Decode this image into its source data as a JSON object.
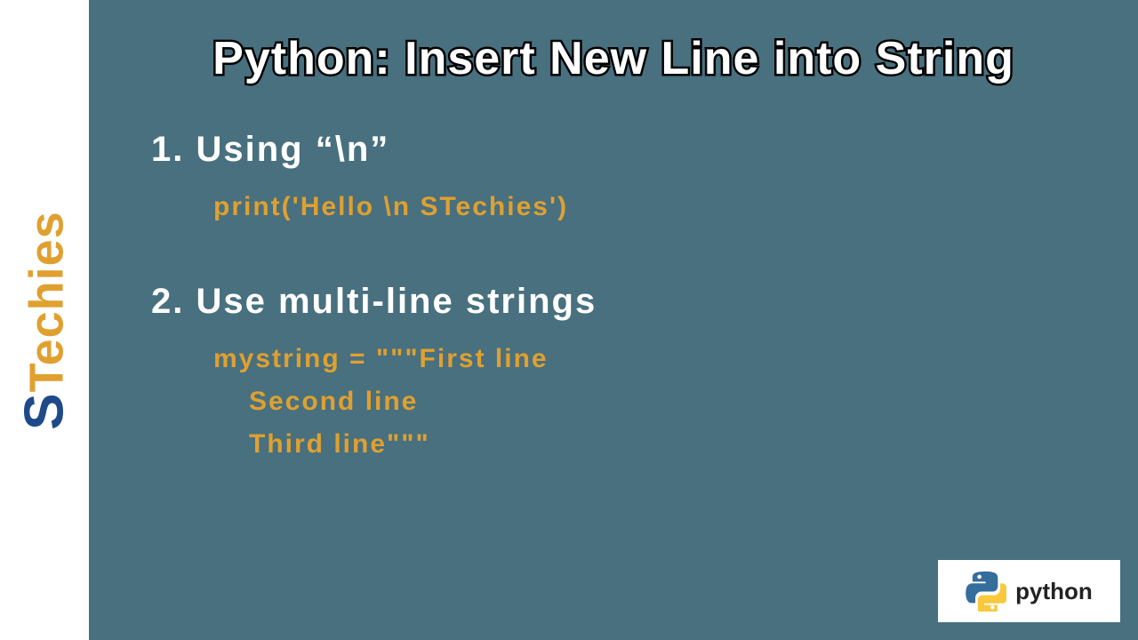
{
  "sidebar": {
    "logo_s": "S",
    "logo_rest": "Techies"
  },
  "title": "Python: Insert New Line into String",
  "section1": {
    "heading": "1. Using “\\n”",
    "code": "print('Hello \\n STechies')"
  },
  "section2": {
    "heading": "2. Use multi-line strings",
    "code_line1": "mystring = \"\"\"First line",
    "code_line2": "Second line",
    "code_line3": "Third line\"\"\""
  },
  "badge": {
    "label": "python"
  }
}
